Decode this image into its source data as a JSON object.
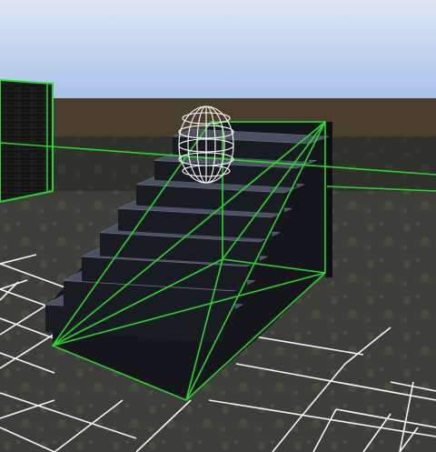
{
  "scene": {
    "sky_top": "#dfe6f3",
    "sky_bottom": "#a9c2ea",
    "horizon_wall": "#4a3e2f",
    "ground": "#3b3b38",
    "ground_patch": "#4c5a3c",
    "grid_color": "#ffffff",
    "collider_color": "#2bd62b",
    "stair_face": "#191b22",
    "stair_tread": "#4a5160",
    "stair_tread_edge": "#6a7385",
    "capsule_color": "#ffffff",
    "brick_wall": "#141414",
    "brick_mortar": "#242424"
  },
  "objects": {
    "staircase": "staircase",
    "player_capsule": "capsule-collider",
    "wall_block": "brick-wall-block",
    "ground_grid": "floor-grid",
    "collider_ramp": "ramp-collider"
  }
}
